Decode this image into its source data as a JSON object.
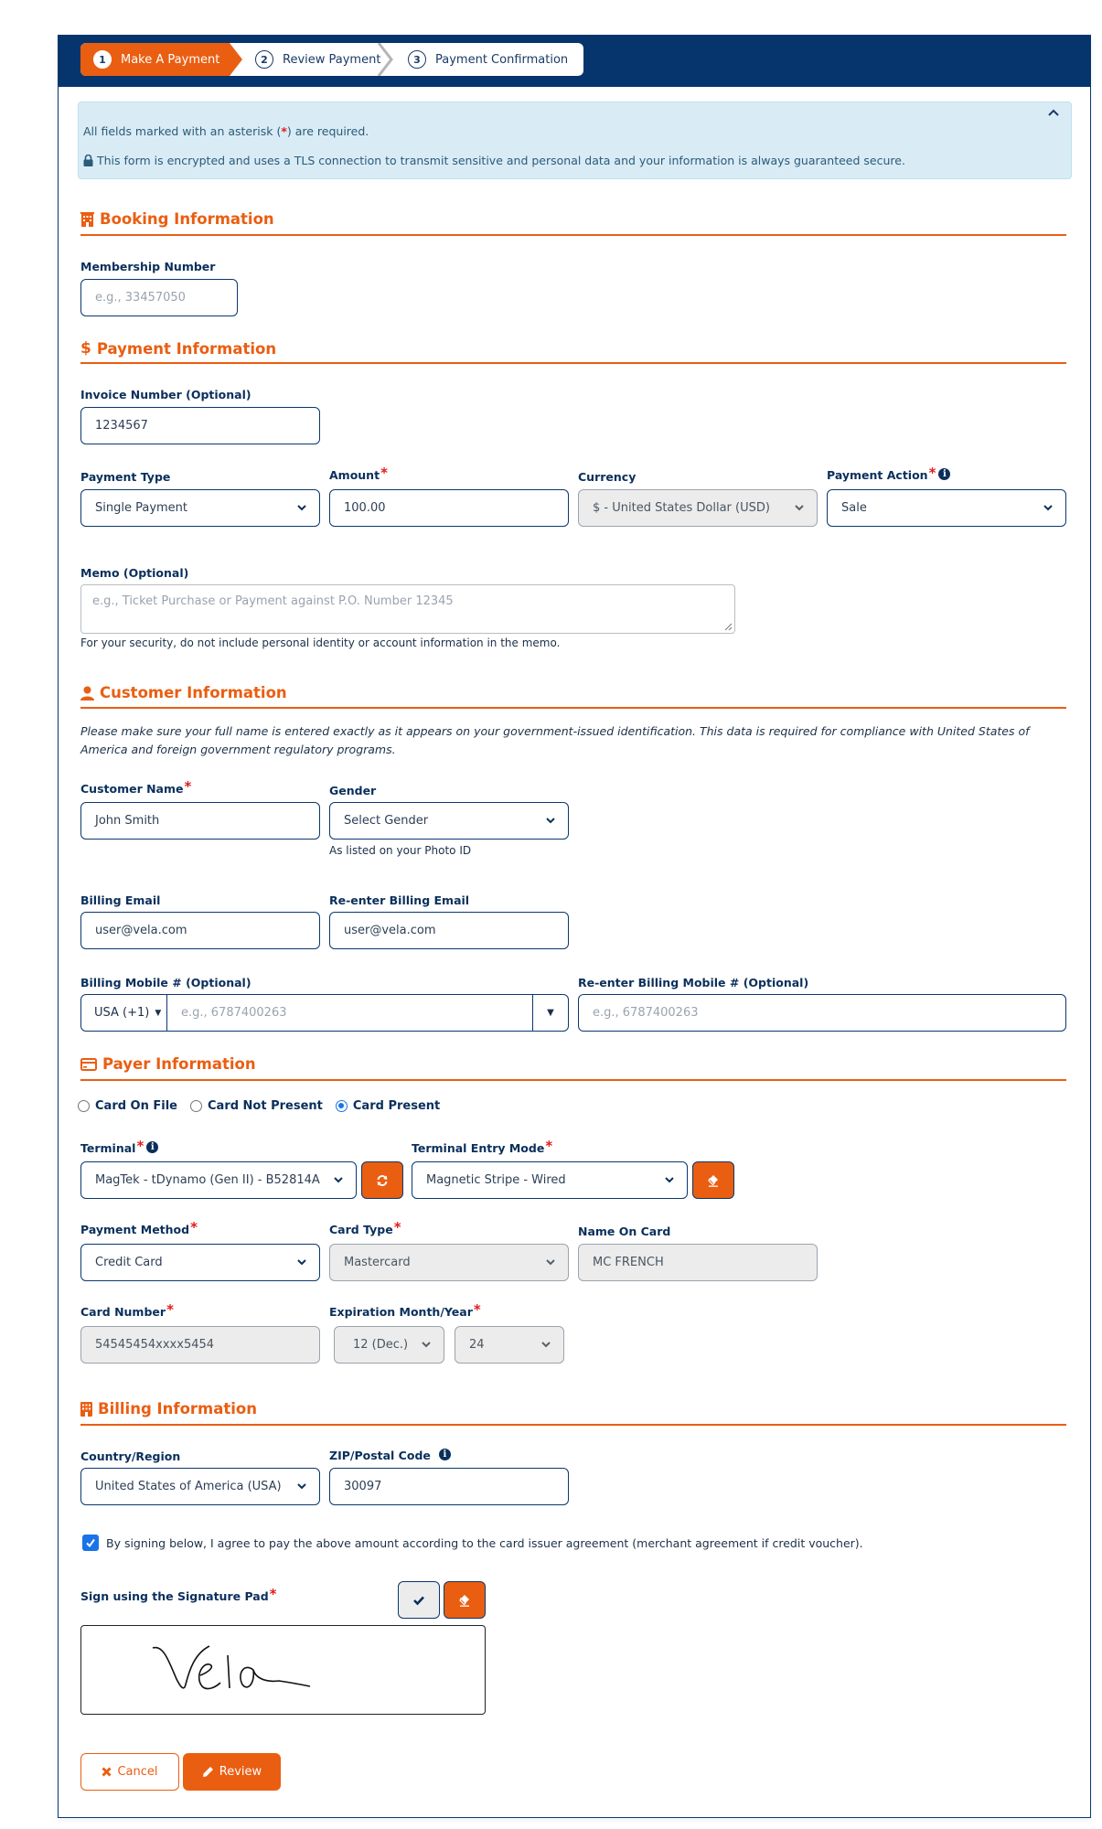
{
  "stepper": {
    "steps": [
      {
        "num": "1",
        "label": "Make A Payment",
        "state": "active"
      },
      {
        "num": "2",
        "label": "Review Payment",
        "state": "pending"
      },
      {
        "num": "3",
        "label": "Payment Confirmation",
        "state": "pending"
      }
    ]
  },
  "alert": {
    "required_prefix": "All fields marked with an asterisk (",
    "required_star": "*",
    "required_suffix": ") are required.",
    "security_text": "This form is encrypted and uses a TLS connection to transmit sensitive and personal data and your information is always guaranteed secure.",
    "collapse_icon": "chevron-up-icon"
  },
  "booking": {
    "title": "Booking Information",
    "icon": "hotel-icon",
    "membership": {
      "label": "Membership Number",
      "placeholder": "e.g., 33457050",
      "value": ""
    }
  },
  "payment": {
    "title": "Payment Information",
    "icon": "dollar-icon",
    "invoice": {
      "label": "Invoice Number (Optional)",
      "value": "1234567"
    },
    "payment_type": {
      "label": "Payment Type",
      "value": "Single Payment"
    },
    "amount": {
      "label": "Amount",
      "required": true,
      "value": "100.00"
    },
    "currency": {
      "label": "Currency",
      "value": "$ - United States Dollar (USD)",
      "disabled": true
    },
    "payment_action": {
      "label": "Payment Action",
      "required": true,
      "value": "Sale"
    },
    "memo": {
      "label": "Memo (Optional)",
      "placeholder": "e.g., Ticket Purchase or Payment against P.O. Number 12345",
      "value": "",
      "help": "For your security, do not include personal identity or account information in the memo."
    }
  },
  "customer": {
    "title": "Customer Information",
    "icon": "user-icon",
    "note": "Please make sure your full name is entered exactly as it appears on your government-issued identification. This data is required for compliance with United States of America and foreign government regulatory programs.",
    "name": {
      "label": "Customer Name",
      "required": true,
      "value": "John Smith"
    },
    "gender": {
      "label": "Gender",
      "value": "Select Gender",
      "help": "As listed on your Photo ID"
    },
    "email": {
      "label": "Billing Email",
      "value": "user@vela.com"
    },
    "email_confirm": {
      "label": "Re-enter Billing Email",
      "value": "user@vela.com"
    },
    "mobile": {
      "label": "Billing Mobile # (Optional)",
      "country_code": "USA (+1)",
      "placeholder": "e.g., 6787400263",
      "value": ""
    },
    "mobile_confirm": {
      "label": "Re-enter Billing Mobile # (Optional)",
      "placeholder": "e.g., 6787400263",
      "value": ""
    }
  },
  "payer": {
    "title": "Payer Information",
    "icon": "credit-card-icon",
    "modes": [
      {
        "label": "Card On File",
        "checked": false
      },
      {
        "label": "Card Not Present",
        "checked": false
      },
      {
        "label": "Card Present",
        "checked": true
      }
    ],
    "terminal": {
      "label": "Terminal",
      "required": true,
      "value": "MagTek - tDynamo (Gen II) - B52814A"
    },
    "entry_mode": {
      "label": "Terminal Entry Mode",
      "required": true,
      "value": "Magnetic Stripe - Wired"
    },
    "payment_method": {
      "label": "Payment Method",
      "required": true,
      "value": "Credit Card"
    },
    "card_type": {
      "label": "Card Type",
      "required": true,
      "value": "Mastercard",
      "disabled": true
    },
    "name_on_card": {
      "label": "Name On Card",
      "value": "MC FRENCH",
      "disabled": true
    },
    "card_number": {
      "label": "Card Number",
      "required": true,
      "value": "54545454xxxx5454",
      "disabled": true
    },
    "expiration": {
      "label": "Expiration Month/Year",
      "required": true,
      "month": "12 (Dec.)",
      "year": "24"
    }
  },
  "billing": {
    "title": "Billing Information",
    "icon": "building-icon",
    "country": {
      "label": "Country/Region",
      "value": "United States of America (USA)"
    },
    "zip": {
      "label": "ZIP/Postal Code",
      "value": "30097"
    },
    "agreement": {
      "checked": true,
      "text": "By signing below, I agree to pay the above amount according to the card issuer agreement (merchant agreement if credit voucher)."
    },
    "signature": {
      "label": "Sign using the Signature Pad",
      "required": true,
      "signed_text": "Vela"
    }
  },
  "actions": {
    "cancel": "Cancel",
    "review": "Review"
  },
  "colors": {
    "brand_orange": "#ea5e11",
    "navy": "#06356d",
    "alert_bg": "#d9ecf5",
    "required_red": "#e21b1b"
  }
}
